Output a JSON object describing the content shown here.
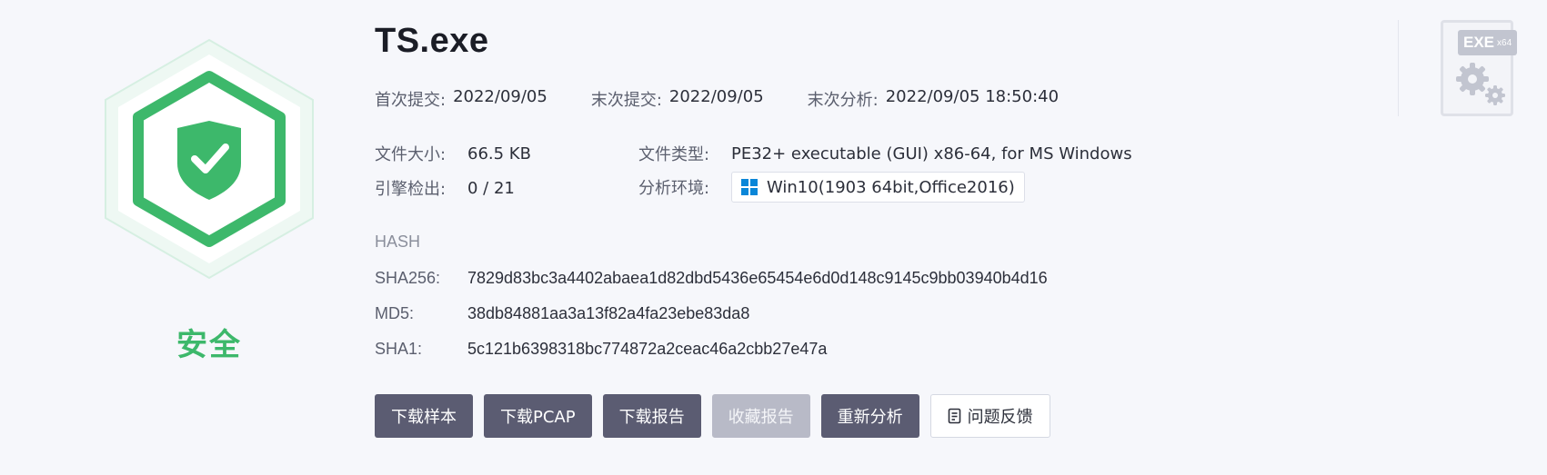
{
  "verdict": {
    "label": "安全",
    "color": "#3db86b",
    "icon": "shield-check-icon"
  },
  "file": {
    "name": "TS.exe"
  },
  "meta": {
    "first_submit_label": "首次提交:",
    "first_submit_value": "2022/09/05",
    "last_submit_label": "末次提交:",
    "last_submit_value": "2022/09/05",
    "last_analysis_label": "末次分析:",
    "last_analysis_value": "2022/09/05 18:50:40"
  },
  "info": {
    "size_label": "文件大小:",
    "size_value": "66.5 KB",
    "type_label": "文件类型:",
    "type_value": "PE32+ executable (GUI) x86-64, for MS Windows",
    "engine_label": "引擎检出:",
    "engine_value": "0 / 21",
    "env_label": "分析环境:",
    "env_value": "Win10(1903 64bit,Office2016)",
    "env_icon": "windows-icon"
  },
  "hash": {
    "title": "HASH",
    "sha256_label": "SHA256:",
    "sha256_value": "7829d83bc3a4402abaea1d82dbd5436e65454e6d0d148c9145c9bb03940b4d16",
    "md5_label": "MD5:",
    "md5_value": "38db84881aa3a13f82a4fa23ebe83da8",
    "sha1_label": "SHA1:",
    "sha1_value": "5c121b6398318bc774872a2ceac46a2cbb27e47a"
  },
  "buttons": {
    "download_sample": "下载样本",
    "download_pcap": "下载PCAP",
    "download_report": "下载报告",
    "favorite_report": "收藏报告",
    "reanalyze": "重新分析",
    "feedback": "问题反馈"
  },
  "file_type_badge": {
    "main": "EXE",
    "sub": "x64",
    "icon": "gear-icon"
  },
  "colors": {
    "button_dark": "#5b5c72",
    "button_disabled": "#b8bac7",
    "safe_green": "#3db86b"
  }
}
